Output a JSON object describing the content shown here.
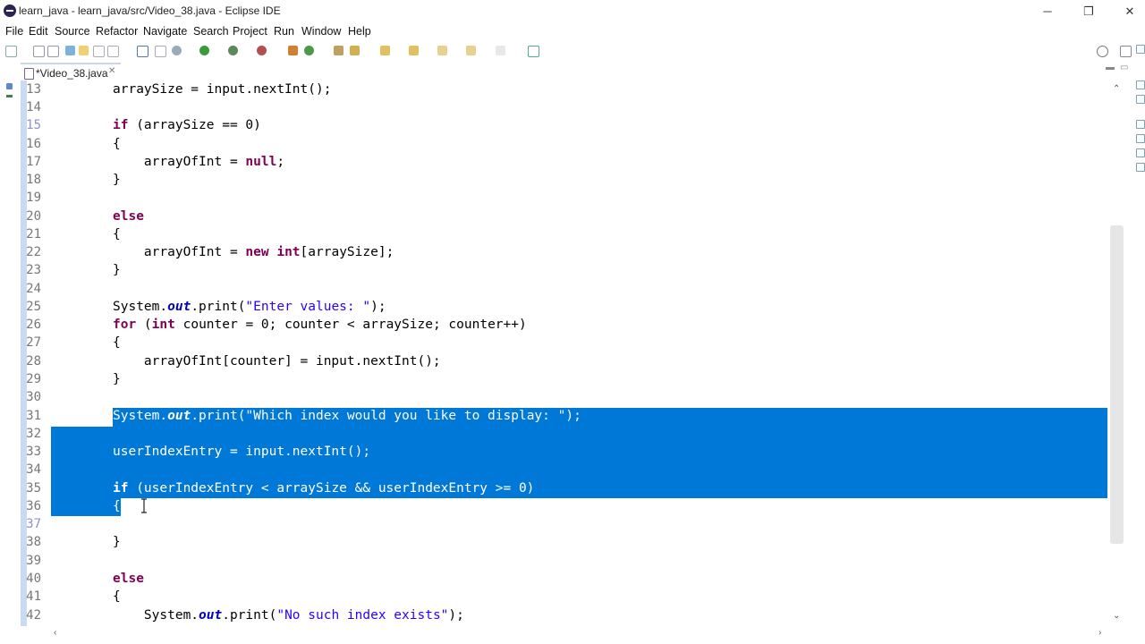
{
  "window": {
    "title": "learn_java - learn_java/src/Video_38.java - Eclipse IDE",
    "controls": [
      "─",
      "❐",
      "✕"
    ]
  },
  "menu": [
    "File",
    "Edit",
    "Source",
    "Refactor",
    "Navigate",
    "Search",
    "Project",
    "Run",
    "Window",
    "Help"
  ],
  "editor_tab": {
    "label": "*Video_38.java",
    "close": "✕"
  },
  "scroll": {
    "up": "⌃",
    "down": "⌄",
    "left": "‹",
    "right": "›"
  },
  "code_lines": [
    {
      "n": "13",
      "text": "arraySize = input.nextInt();"
    },
    {
      "n": "14",
      "text": ""
    },
    {
      "n": "15",
      "text": "if (arraySize == 0)"
    },
    {
      "n": "16",
      "text": "{"
    },
    {
      "n": "17",
      "text": "    arrayOfInt = null;"
    },
    {
      "n": "18",
      "text": "}"
    },
    {
      "n": "19",
      "text": ""
    },
    {
      "n": "20",
      "text": "else"
    },
    {
      "n": "21",
      "text": "{"
    },
    {
      "n": "22",
      "text": "    arrayOfInt = new int[arraySize];"
    },
    {
      "n": "23",
      "text": "}"
    },
    {
      "n": "24",
      "text": ""
    },
    {
      "n": "25",
      "text": "System.out.print(\"Enter values: \");"
    },
    {
      "n": "26",
      "text": "for (int counter = 0; counter < arraySize; counter++)"
    },
    {
      "n": "27",
      "text": "{"
    },
    {
      "n": "28",
      "text": "    arrayOfInt[counter] = input.nextInt();"
    },
    {
      "n": "29",
      "text": "}"
    },
    {
      "n": "30",
      "text": ""
    },
    {
      "n": "31",
      "text": "System.out.print(\"Which index would you like to display: \");"
    },
    {
      "n": "32",
      "text": ""
    },
    {
      "n": "33",
      "text": "userIndexEntry = input.nextInt();"
    },
    {
      "n": "34",
      "text": ""
    },
    {
      "n": "35",
      "text": "if (userIndexEntry < arraySize && userIndexEntry >= 0)"
    },
    {
      "n": "36",
      "text": "{"
    },
    {
      "n": "37",
      "text": ""
    },
    {
      "n": "38",
      "text": "}"
    },
    {
      "n": "39",
      "text": ""
    },
    {
      "n": "40",
      "text": "else"
    },
    {
      "n": "41",
      "text": "{"
    },
    {
      "n": "42",
      "text": "    System.out.print(\"No such index exists\");"
    }
  ],
  "selection": {
    "first_line": "31",
    "last_line": "36"
  },
  "colors": {
    "selection": "#0078d7",
    "keyword": "#7f0055",
    "string": "#2a00ff",
    "field": "#0000c0"
  }
}
